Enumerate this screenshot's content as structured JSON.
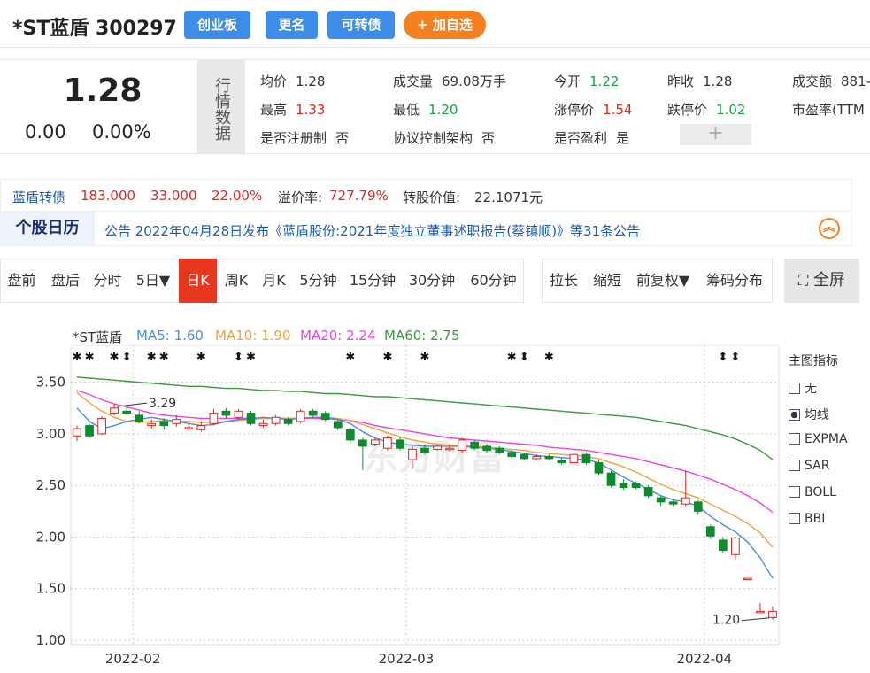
{
  "header": {
    "title": "*ST蓝盾 300297",
    "buttons": [
      "创业板",
      "更名",
      "可转债",
      "+ 加自选"
    ]
  },
  "quote": {
    "price": "1.28",
    "change": "0.00",
    "change_pct": "0.00%",
    "side_label": "行情数据",
    "fields": [
      {
        "label": "均价",
        "value": "1.28",
        "color": "normal"
      },
      {
        "label": "成交量",
        "value": "69.08万手",
        "color": "normal"
      },
      {
        "label": "今开",
        "value": "1.22",
        "color": "green"
      },
      {
        "label": "昨收",
        "value": "1.28",
        "color": "normal"
      },
      {
        "label": "成交额",
        "value": "881-",
        "color": "normal"
      },
      {
        "label": "最高",
        "value": "1.33",
        "color": "red"
      },
      {
        "label": "最低",
        "value": "1.20",
        "color": "green"
      },
      {
        "label": "涨停价",
        "value": "1.54",
        "color": "red"
      },
      {
        "label": "跌停价",
        "value": "1.02",
        "color": "green"
      },
      {
        "label": "市盈率(TTM",
        "value": "",
        "color": "normal"
      },
      {
        "label": "是否注册制",
        "value": "否",
        "color": "normal"
      },
      {
        "label": "协议控制架构",
        "value": "否",
        "color": "normal"
      },
      {
        "label": "是否盈利",
        "value": "是",
        "color": "normal"
      }
    ],
    "plus": "+"
  },
  "bond": {
    "name": "蓝盾转债",
    "price": "183.000",
    "change": "33.000",
    "pct": "22.00%",
    "premium_label": "溢价率:",
    "premium": "727.79%",
    "conv_label": "转股价值:",
    "conv": "22.1071元"
  },
  "calendar": {
    "title": "个股日历",
    "notice": "公告 2022年04月28日发布《蓝盾股份:2021年度独立董事述职报告(蔡镇顺)》等31条公告"
  },
  "tabs": [
    "盘前",
    "盘后",
    "分时",
    "5日▼",
    "日K",
    "周K",
    "月K",
    "5分钟",
    "15分钟",
    "30分钟",
    "60分钟"
  ],
  "active_tab": "日K",
  "tools": [
    "拉长",
    "缩短",
    "前复权▼",
    "筹码分布"
  ],
  "fullscreen": "全屏",
  "ma_legend": {
    "name": "*ST蓝盾",
    "ma5": "MA5: 1.60",
    "ma10": "MA10: 1.90",
    "ma20": "MA20: 2.24",
    "ma60": "MA60: 2.75"
  },
  "indicator_panel": {
    "title": "主图指标",
    "items": [
      {
        "label": "无",
        "checked": false
      },
      {
        "label": "均线",
        "checked": true
      },
      {
        "label": "EXPMA",
        "checked": false
      },
      {
        "label": "SAR",
        "checked": false
      },
      {
        "label": "BOLL",
        "checked": false
      },
      {
        "label": "BBI",
        "checked": false
      }
    ]
  },
  "colors": {
    "up": "#e0241b",
    "down": "#0f8a2d",
    "ma5": "#4a8ee0",
    "ma10": "#f0a23c",
    "ma20": "#ee3fe4",
    "ma60": "#3a9b3a",
    "accent": "#3d8de8"
  },
  "chart_data": {
    "type": "candlestick",
    "y_ticks": [
      "3.50",
      "3.00",
      "2.50",
      "2.00",
      "1.50",
      "1.00"
    ],
    "x_ticks": [
      "2022-02",
      "2022-03",
      "2022-04"
    ],
    "ylim": [
      1.0,
      3.6
    ],
    "annotations": {
      "high": "3.29",
      "low": "1.20"
    },
    "candles": [
      {
        "o": 2.98,
        "c": 3.05,
        "h": 3.08,
        "l": 2.93
      },
      {
        "o": 3.08,
        "c": 2.98,
        "h": 3.1,
        "l": 2.96
      },
      {
        "o": 3.0,
        "c": 3.15,
        "h": 3.17,
        "l": 2.99
      },
      {
        "o": 3.2,
        "c": 3.25,
        "h": 3.29,
        "l": 3.18
      },
      {
        "o": 3.22,
        "c": 3.2,
        "h": 3.26,
        "l": 3.18
      },
      {
        "o": 3.18,
        "c": 3.12,
        "h": 3.22,
        "l": 3.1
      },
      {
        "o": 3.08,
        "c": 3.1,
        "h": 3.14,
        "l": 3.05
      },
      {
        "o": 3.12,
        "c": 3.08,
        "h": 3.15,
        "l": 3.04
      },
      {
        "o": 3.1,
        "c": 3.14,
        "h": 3.18,
        "l": 3.07
      },
      {
        "o": 3.06,
        "c": 3.06,
        "h": 3.1,
        "l": 3.03
      },
      {
        "o": 3.04,
        "c": 3.08,
        "h": 3.12,
        "l": 3.02
      },
      {
        "o": 3.1,
        "c": 3.2,
        "h": 3.24,
        "l": 3.08
      },
      {
        "o": 3.22,
        "c": 3.18,
        "h": 3.25,
        "l": 3.15
      },
      {
        "o": 3.16,
        "c": 3.22,
        "h": 3.24,
        "l": 3.14
      },
      {
        "o": 3.2,
        "c": 3.1,
        "h": 3.22,
        "l": 3.08
      },
      {
        "o": 3.08,
        "c": 3.1,
        "h": 3.14,
        "l": 3.06
      },
      {
        "o": 3.1,
        "c": 3.16,
        "h": 3.18,
        "l": 3.08
      },
      {
        "o": 3.14,
        "c": 3.1,
        "h": 3.16,
        "l": 3.08
      },
      {
        "o": 3.12,
        "c": 3.22,
        "h": 3.24,
        "l": 3.1
      },
      {
        "o": 3.22,
        "c": 3.18,
        "h": 3.24,
        "l": 3.16
      },
      {
        "o": 3.2,
        "c": 3.14,
        "h": 3.22,
        "l": 3.12
      },
      {
        "o": 3.12,
        "c": 3.06,
        "h": 3.14,
        "l": 3.04
      },
      {
        "o": 3.04,
        "c": 2.94,
        "h": 3.06,
        "l": 2.9
      },
      {
        "o": 2.94,
        "c": 2.88,
        "h": 2.96,
        "l": 2.65
      },
      {
        "o": 2.9,
        "c": 2.94,
        "h": 2.96,
        "l": 2.88
      },
      {
        "o": 2.86,
        "c": 2.96,
        "h": 2.98,
        "l": 2.84
      },
      {
        "o": 2.94,
        "c": 2.86,
        "h": 2.97,
        "l": 2.84
      },
      {
        "o": 2.75,
        "c": 2.85,
        "h": 2.88,
        "l": 2.66
      },
      {
        "o": 2.86,
        "c": 2.82,
        "h": 2.9,
        "l": 2.8
      },
      {
        "o": 2.85,
        "c": 2.88,
        "h": 2.9,
        "l": 2.84
      },
      {
        "o": 2.86,
        "c": 2.86,
        "h": 2.9,
        "l": 2.83
      },
      {
        "o": 2.84,
        "c": 2.94,
        "h": 2.96,
        "l": 2.82
      },
      {
        "o": 2.92,
        "c": 2.86,
        "h": 2.94,
        "l": 2.84
      },
      {
        "o": 2.88,
        "c": 2.84,
        "h": 2.9,
        "l": 2.82
      },
      {
        "o": 2.86,
        "c": 2.82,
        "h": 2.88,
        "l": 2.8
      },
      {
        "o": 2.82,
        "c": 2.78,
        "h": 2.84,
        "l": 2.76
      },
      {
        "o": 2.8,
        "c": 2.76,
        "h": 2.82,
        "l": 2.74
      },
      {
        "o": 2.76,
        "c": 2.78,
        "h": 2.8,
        "l": 2.74
      },
      {
        "o": 2.78,
        "c": 2.76,
        "h": 2.8,
        "l": 2.74
      },
      {
        "o": 2.74,
        "c": 2.72,
        "h": 2.77,
        "l": 2.7
      },
      {
        "o": 2.72,
        "c": 2.8,
        "h": 2.82,
        "l": 2.7
      },
      {
        "o": 2.8,
        "c": 2.72,
        "h": 2.82,
        "l": 2.7
      },
      {
        "o": 2.72,
        "c": 2.62,
        "h": 2.74,
        "l": 2.6
      },
      {
        "o": 2.62,
        "c": 2.5,
        "h": 2.64,
        "l": 2.48
      },
      {
        "o": 2.52,
        "c": 2.48,
        "h": 2.56,
        "l": 2.46
      },
      {
        "o": 2.52,
        "c": 2.48,
        "h": 2.54,
        "l": 2.46
      },
      {
        "o": 2.48,
        "c": 2.4,
        "h": 2.5,
        "l": 2.38
      },
      {
        "o": 2.38,
        "c": 2.34,
        "h": 2.4,
        "l": 2.3
      },
      {
        "o": 2.34,
        "c": 2.32,
        "h": 2.36,
        "l": 2.3
      },
      {
        "o": 2.32,
        "c": 2.38,
        "h": 2.64,
        "l": 2.3
      },
      {
        "o": 2.34,
        "c": 2.25,
        "h": 2.36,
        "l": 2.22
      },
      {
        "o": 2.1,
        "c": 2.01,
        "h": 2.12,
        "l": 1.98
      },
      {
        "o": 1.97,
        "c": 1.87,
        "h": 2.0,
        "l": 1.85
      },
      {
        "o": 1.83,
        "c": 1.99,
        "h": 2.0,
        "l": 1.78
      },
      {
        "o": 1.6,
        "c": 1.6,
        "h": 1.6,
        "l": 1.6
      },
      {
        "o": 1.28,
        "c": 1.28,
        "h": 1.36,
        "l": 1.28
      },
      {
        "o": 1.22,
        "c": 1.28,
        "h": 1.33,
        "l": 1.2
      }
    ],
    "ma5": [
      3.25,
      3.12,
      3.05,
      3.08,
      3.12,
      3.14,
      3.16,
      3.14,
      3.12,
      3.1,
      3.08,
      3.09,
      3.12,
      3.14,
      3.15,
      3.16,
      3.15,
      3.14,
      3.15,
      3.16,
      3.16,
      3.14,
      3.1,
      3.02,
      2.96,
      2.92,
      2.9,
      2.89,
      2.88,
      2.88,
      2.88,
      2.88,
      2.87,
      2.86,
      2.85,
      2.83,
      2.81,
      2.79,
      2.78,
      2.77,
      2.76,
      2.75,
      2.72,
      2.65,
      2.58,
      2.52,
      2.46,
      2.4,
      2.36,
      2.34,
      2.3,
      2.2,
      2.12,
      2.05,
      1.95,
      1.8,
      1.6
    ],
    "ma10": [
      3.4,
      3.3,
      3.22,
      3.16,
      3.12,
      3.11,
      3.12,
      3.13,
      3.13,
      3.12,
      3.11,
      3.11,
      3.12,
      3.13,
      3.14,
      3.15,
      3.15,
      3.15,
      3.15,
      3.16,
      3.16,
      3.15,
      3.13,
      3.09,
      3.05,
      3.01,
      2.97,
      2.94,
      2.92,
      2.9,
      2.89,
      2.89,
      2.88,
      2.87,
      2.86,
      2.85,
      2.84,
      2.82,
      2.81,
      2.8,
      2.79,
      2.78,
      2.76,
      2.72,
      2.68,
      2.63,
      2.57,
      2.51,
      2.46,
      2.42,
      2.38,
      2.32,
      2.26,
      2.2,
      2.13,
      2.04,
      1.9
    ],
    "ma20": [
      3.42,
      3.38,
      3.33,
      3.29,
      3.26,
      3.23,
      3.2,
      3.18,
      3.17,
      3.16,
      3.15,
      3.15,
      3.15,
      3.15,
      3.15,
      3.15,
      3.15,
      3.15,
      3.15,
      3.15,
      3.15,
      3.14,
      3.13,
      3.11,
      3.08,
      3.06,
      3.04,
      3.02,
      3.0,
      2.98,
      2.96,
      2.95,
      2.94,
      2.93,
      2.92,
      2.91,
      2.9,
      2.89,
      2.87,
      2.86,
      2.85,
      2.84,
      2.82,
      2.8,
      2.78,
      2.76,
      2.73,
      2.7,
      2.67,
      2.64,
      2.6,
      2.56,
      2.51,
      2.46,
      2.4,
      2.33,
      2.24
    ],
    "ma60": [
      3.55,
      3.54,
      3.53,
      3.52,
      3.51,
      3.5,
      3.49,
      3.48,
      3.47,
      3.46,
      3.46,
      3.45,
      3.44,
      3.44,
      3.43,
      3.42,
      3.42,
      3.41,
      3.41,
      3.4,
      3.39,
      3.39,
      3.38,
      3.37,
      3.36,
      3.36,
      3.35,
      3.34,
      3.33,
      3.32,
      3.31,
      3.3,
      3.29,
      3.28,
      3.27,
      3.26,
      3.25,
      3.24,
      3.23,
      3.22,
      3.21,
      3.2,
      3.19,
      3.18,
      3.17,
      3.16,
      3.14,
      3.12,
      3.1,
      3.08,
      3.05,
      3.02,
      2.99,
      2.95,
      2.9,
      2.84,
      2.75
    ]
  }
}
